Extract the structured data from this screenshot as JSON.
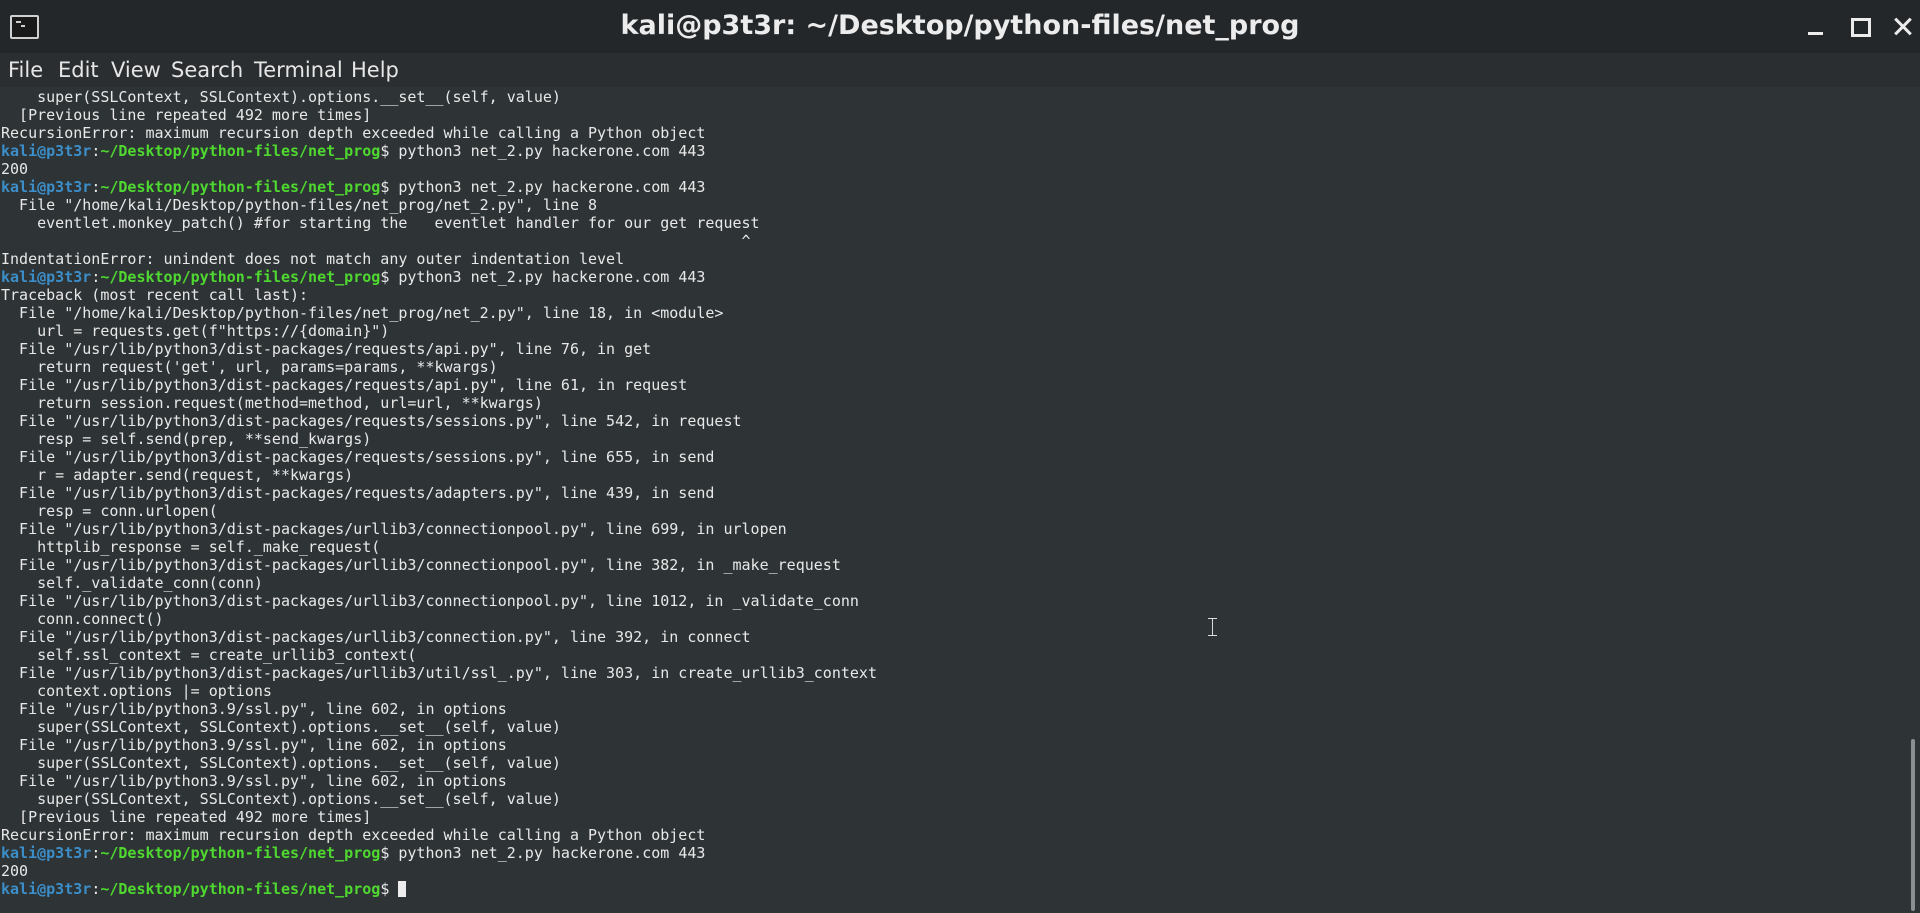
{
  "window": {
    "title": "kali@p3t3r: ~/Desktop/python-files/net_prog"
  },
  "menubar": {
    "items": [
      "File",
      "Edit",
      "View",
      "Search",
      "Terminal",
      "Help"
    ]
  },
  "colors": {
    "prompt_user": "#3c8ec9",
    "prompt_path": "#4fd82f",
    "text": "#e8e8e8",
    "background": "#2e3436"
  },
  "prompt": {
    "user_host": "kali@p3t3r",
    "separator": ":",
    "path": "~/Desktop/python-files/net_prog",
    "symbol": "$ "
  },
  "terminal": {
    "lines": [
      {
        "text": "    super(SSLContext, SSLContext).options.__set__(self, value)"
      },
      {
        "text": "  [Previous line repeated 492 more times]"
      },
      {
        "text": "RecursionError: maximum recursion depth exceeded while calling a Python object"
      },
      {
        "prompt": true,
        "cmd": "python3 net_2.py hackerone.com 443"
      },
      {
        "text": "200"
      },
      {
        "prompt": true,
        "cmd": "python3 net_2.py hackerone.com 443"
      },
      {
        "text": "  File \"/home/kali/Desktop/python-files/net_prog/net_2.py\", line 8"
      },
      {
        "text": "    eventlet.monkey_patch() #for starting the   eventlet handler for our get request"
      },
      {
        "text": "                                                                                  ^"
      },
      {
        "text": "IndentationError: unindent does not match any outer indentation level"
      },
      {
        "prompt": true,
        "cmd": "python3 net_2.py hackerone.com 443"
      },
      {
        "text": "Traceback (most recent call last):"
      },
      {
        "text": "  File \"/home/kali/Desktop/python-files/net_prog/net_2.py\", line 18, in <module>"
      },
      {
        "text": "    url = requests.get(f\"https://{domain}\")"
      },
      {
        "text": "  File \"/usr/lib/python3/dist-packages/requests/api.py\", line 76, in get"
      },
      {
        "text": "    return request('get', url, params=params, **kwargs)"
      },
      {
        "text": "  File \"/usr/lib/python3/dist-packages/requests/api.py\", line 61, in request"
      },
      {
        "text": "    return session.request(method=method, url=url, **kwargs)"
      },
      {
        "text": "  File \"/usr/lib/python3/dist-packages/requests/sessions.py\", line 542, in request"
      },
      {
        "text": "    resp = self.send(prep, **send_kwargs)"
      },
      {
        "text": "  File \"/usr/lib/python3/dist-packages/requests/sessions.py\", line 655, in send"
      },
      {
        "text": "    r = adapter.send(request, **kwargs)"
      },
      {
        "text": "  File \"/usr/lib/python3/dist-packages/requests/adapters.py\", line 439, in send"
      },
      {
        "text": "    resp = conn.urlopen("
      },
      {
        "text": "  File \"/usr/lib/python3/dist-packages/urllib3/connectionpool.py\", line 699, in urlopen"
      },
      {
        "text": "    httplib_response = self._make_request("
      },
      {
        "text": "  File \"/usr/lib/python3/dist-packages/urllib3/connectionpool.py\", line 382, in _make_request"
      },
      {
        "text": "    self._validate_conn(conn)"
      },
      {
        "text": "  File \"/usr/lib/python3/dist-packages/urllib3/connectionpool.py\", line 1012, in _validate_conn"
      },
      {
        "text": "    conn.connect()"
      },
      {
        "text": "  File \"/usr/lib/python3/dist-packages/urllib3/connection.py\", line 392, in connect"
      },
      {
        "text": "    self.ssl_context = create_urllib3_context("
      },
      {
        "text": "  File \"/usr/lib/python3/dist-packages/urllib3/util/ssl_.py\", line 303, in create_urllib3_context"
      },
      {
        "text": "    context.options |= options"
      },
      {
        "text": "  File \"/usr/lib/python3.9/ssl.py\", line 602, in options"
      },
      {
        "text": "    super(SSLContext, SSLContext).options.__set__(self, value)"
      },
      {
        "text": "  File \"/usr/lib/python3.9/ssl.py\", line 602, in options"
      },
      {
        "text": "    super(SSLContext, SSLContext).options.__set__(self, value)"
      },
      {
        "text": "  File \"/usr/lib/python3.9/ssl.py\", line 602, in options"
      },
      {
        "text": "    super(SSLContext, SSLContext).options.__set__(self, value)"
      },
      {
        "text": "  [Previous line repeated 492 more times]"
      },
      {
        "text": "RecursionError: maximum recursion depth exceeded while calling a Python object"
      },
      {
        "prompt": true,
        "cmd": "python3 net_2.py hackerone.com 443"
      },
      {
        "text": "200"
      },
      {
        "prompt": true,
        "cmd": "",
        "cursor": true
      }
    ]
  }
}
